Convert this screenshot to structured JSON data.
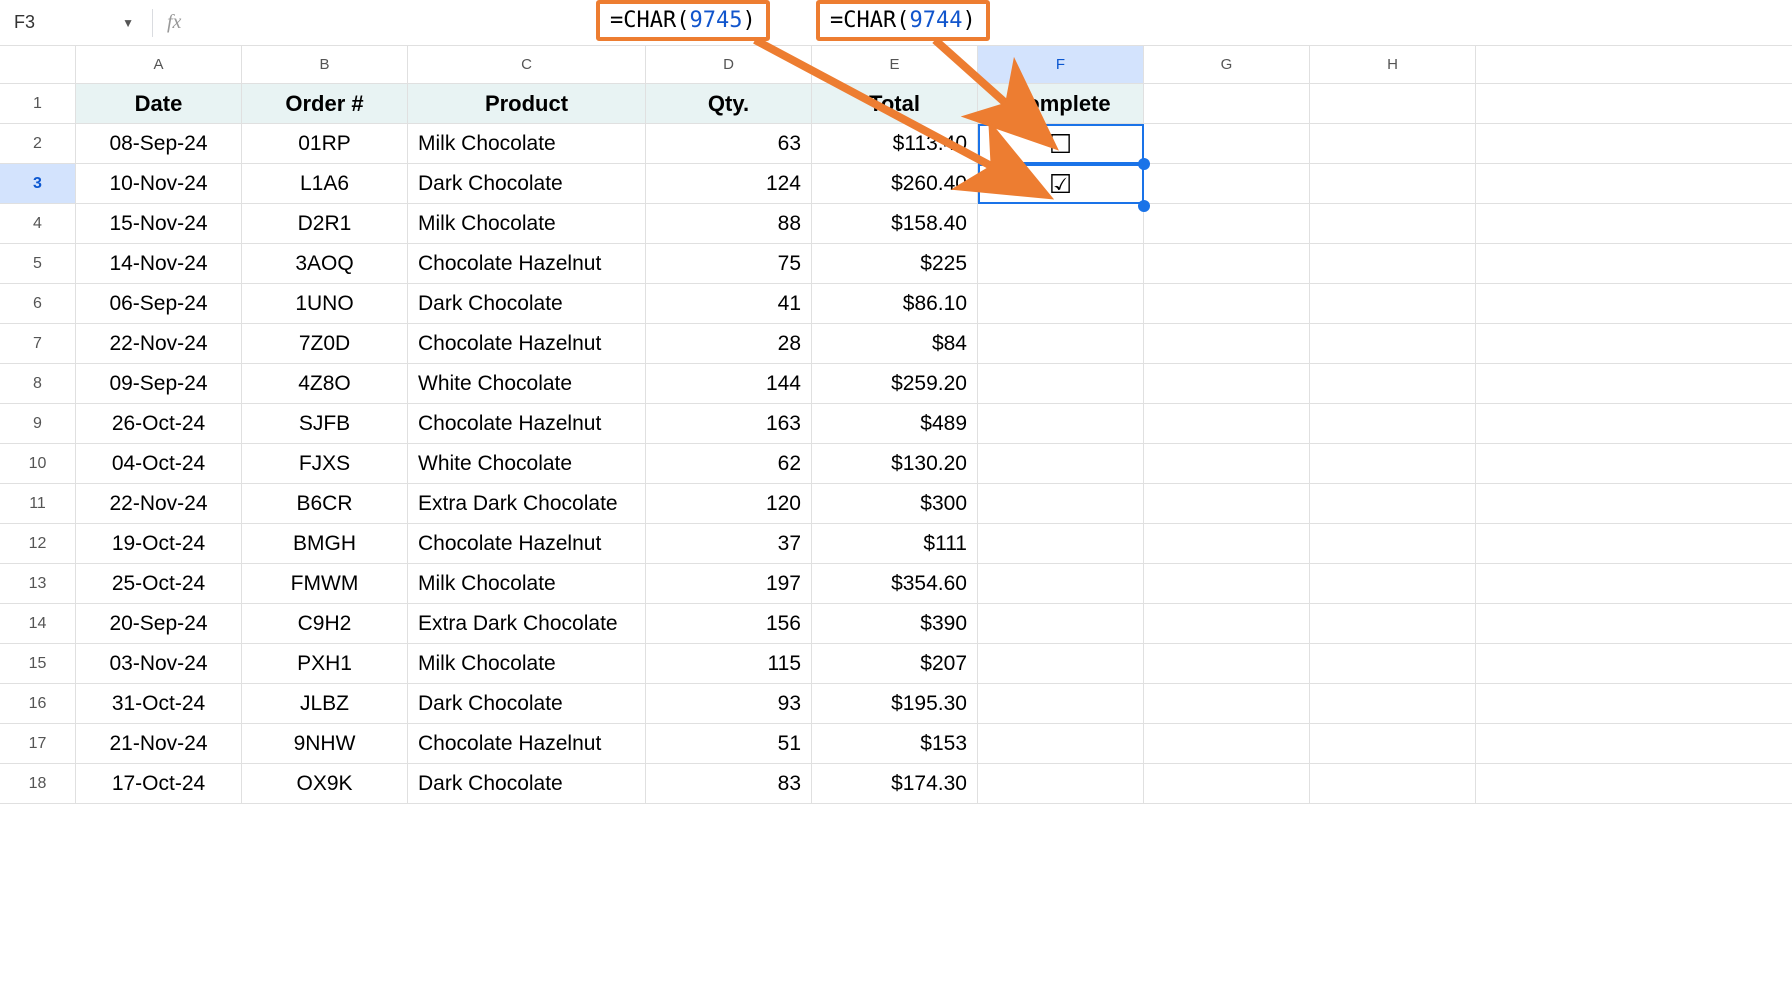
{
  "name_box": {
    "value": "F3"
  },
  "callouts": {
    "left": {
      "prefix": "=CHAR",
      "open": "(",
      "num": "9745",
      "close": ")"
    },
    "right": {
      "prefix": "=CHAR",
      "open": "(",
      "num": "9744",
      "close": ")"
    }
  },
  "columns": [
    "A",
    "B",
    "C",
    "D",
    "E",
    "F",
    "G",
    "H"
  ],
  "selected_col": "F",
  "selected_row": "3",
  "row_numbers": [
    "1",
    "2",
    "3",
    "4",
    "5",
    "6",
    "7",
    "8",
    "9",
    "10",
    "11",
    "12",
    "13",
    "14",
    "15",
    "16",
    "17",
    "18"
  ],
  "headers": {
    "A": "Date",
    "B": "Order #",
    "C": "Product",
    "D": "Qty.",
    "E": "Total",
    "F": "Complete"
  },
  "checkbox": {
    "unchecked": "☐",
    "checked": "☑"
  },
  "rows": [
    {
      "date": "08-Sep-24",
      "order": "01RP",
      "product": "Milk Chocolate",
      "qty": "63",
      "total": "$113.40",
      "complete": "unchecked"
    },
    {
      "date": "10-Nov-24",
      "order": "L1A6",
      "product": "Dark Chocolate",
      "qty": "124",
      "total": "$260.40",
      "complete": "checked"
    },
    {
      "date": "15-Nov-24",
      "order": "D2R1",
      "product": "Milk Chocolate",
      "qty": "88",
      "total": "$158.40",
      "complete": ""
    },
    {
      "date": "14-Nov-24",
      "order": "3AOQ",
      "product": "Chocolate Hazelnut",
      "qty": "75",
      "total": "$225",
      "complete": ""
    },
    {
      "date": "06-Sep-24",
      "order": "1UNO",
      "product": "Dark Chocolate",
      "qty": "41",
      "total": "$86.10",
      "complete": ""
    },
    {
      "date": "22-Nov-24",
      "order": "7Z0D",
      "product": "Chocolate Hazelnut",
      "qty": "28",
      "total": "$84",
      "complete": ""
    },
    {
      "date": "09-Sep-24",
      "order": "4Z8O",
      "product": "White Chocolate",
      "qty": "144",
      "total": "$259.20",
      "complete": ""
    },
    {
      "date": "26-Oct-24",
      "order": "SJFB",
      "product": "Chocolate Hazelnut",
      "qty": "163",
      "total": "$489",
      "complete": ""
    },
    {
      "date": "04-Oct-24",
      "order": "FJXS",
      "product": "White Chocolate",
      "qty": "62",
      "total": "$130.20",
      "complete": ""
    },
    {
      "date": "22-Nov-24",
      "order": "B6CR",
      "product": "Extra Dark Chocolate",
      "qty": "120",
      "total": "$300",
      "complete": ""
    },
    {
      "date": "19-Oct-24",
      "order": "BMGH",
      "product": "Chocolate Hazelnut",
      "qty": "37",
      "total": "$111",
      "complete": ""
    },
    {
      "date": "25-Oct-24",
      "order": "FMWM",
      "product": "Milk Chocolate",
      "qty": "197",
      "total": "$354.60",
      "complete": ""
    },
    {
      "date": "20-Sep-24",
      "order": "C9H2",
      "product": "Extra Dark Chocolate",
      "qty": "156",
      "total": "$390",
      "complete": ""
    },
    {
      "date": "03-Nov-24",
      "order": "PXH1",
      "product": "Milk Chocolate",
      "qty": "115",
      "total": "$207",
      "complete": ""
    },
    {
      "date": "31-Oct-24",
      "order": "JLBZ",
      "product": "Dark Chocolate",
      "qty": "93",
      "total": "$195.30",
      "complete": ""
    },
    {
      "date": "21-Nov-24",
      "order": "9NHW",
      "product": "Chocolate Hazelnut",
      "qty": "51",
      "total": "$153",
      "complete": ""
    },
    {
      "date": "17-Oct-24",
      "order": "OX9K",
      "product": "Dark Chocolate",
      "qty": "83",
      "total": "$174.30",
      "complete": ""
    }
  ]
}
